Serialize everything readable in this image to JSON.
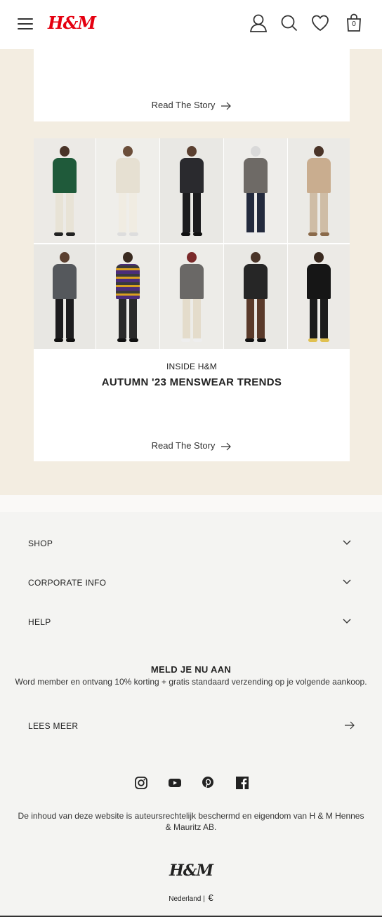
{
  "header": {
    "logo": "H&M",
    "bag_count": "0",
    "icons": [
      "menu-icon",
      "account-icon",
      "search-icon",
      "heart-icon",
      "bag-icon"
    ]
  },
  "stories": [
    {
      "read_label": "Read The Story"
    },
    {
      "kicker": "INSIDE H&M",
      "headline": "AUTUMN '23 MENSWEAR TRENDS",
      "read_label": "Read The Story"
    }
  ],
  "footer": {
    "accordion": [
      "SHOP",
      "CORPORATE INFO",
      "HELP"
    ],
    "join": {
      "title": "MELD JE NU AAN",
      "text": "Word member en ontvang 10% korting + gratis standaard verzending op je volgende aankoop.",
      "link": "LEES MEER"
    },
    "social": [
      "instagram-icon",
      "youtube-icon",
      "pinterest-icon",
      "facebook-icon"
    ],
    "copyright": "De inhoud van deze website is auteursrechtelijk beschermd en eigendom van H & M Hennes & Mauritz AB.",
    "logo": "H&M",
    "country": "Nederland",
    "separator": "|",
    "currency": "€"
  },
  "colors": {
    "brand_red": "#e50010",
    "beige": "#f3ede1",
    "footer_bg": "#f4f4f2"
  }
}
